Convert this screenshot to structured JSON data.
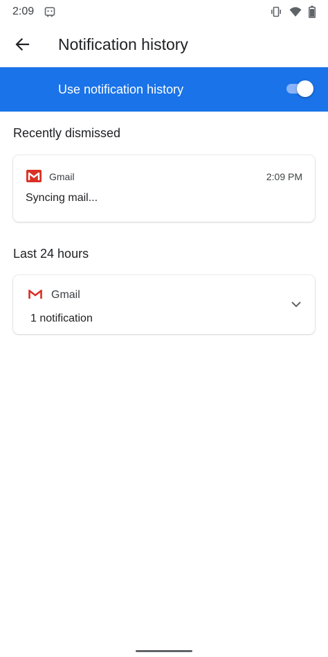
{
  "status_bar": {
    "time": "2:09",
    "icons": [
      "notification-icon",
      "vibrate-icon",
      "wifi-icon",
      "battery-icon"
    ]
  },
  "app_bar": {
    "title": "Notification history",
    "back_icon": "arrow-back-icon"
  },
  "master_switch": {
    "label": "Use notification history",
    "enabled": true,
    "accent_color": "#1a73e8"
  },
  "sections": [
    {
      "header": "Recently dismissed",
      "items": [
        {
          "app_name": "Gmail",
          "app_icon": "gmail-icon",
          "time": "2:09 PM",
          "text": "Syncing mail..."
        }
      ]
    },
    {
      "header": "Last 24 hours",
      "items": [
        {
          "app_name": "Gmail",
          "app_icon": "gmail-icon",
          "summary": "1 notification",
          "expand_icon": "chevron-down-icon"
        }
      ]
    }
  ]
}
